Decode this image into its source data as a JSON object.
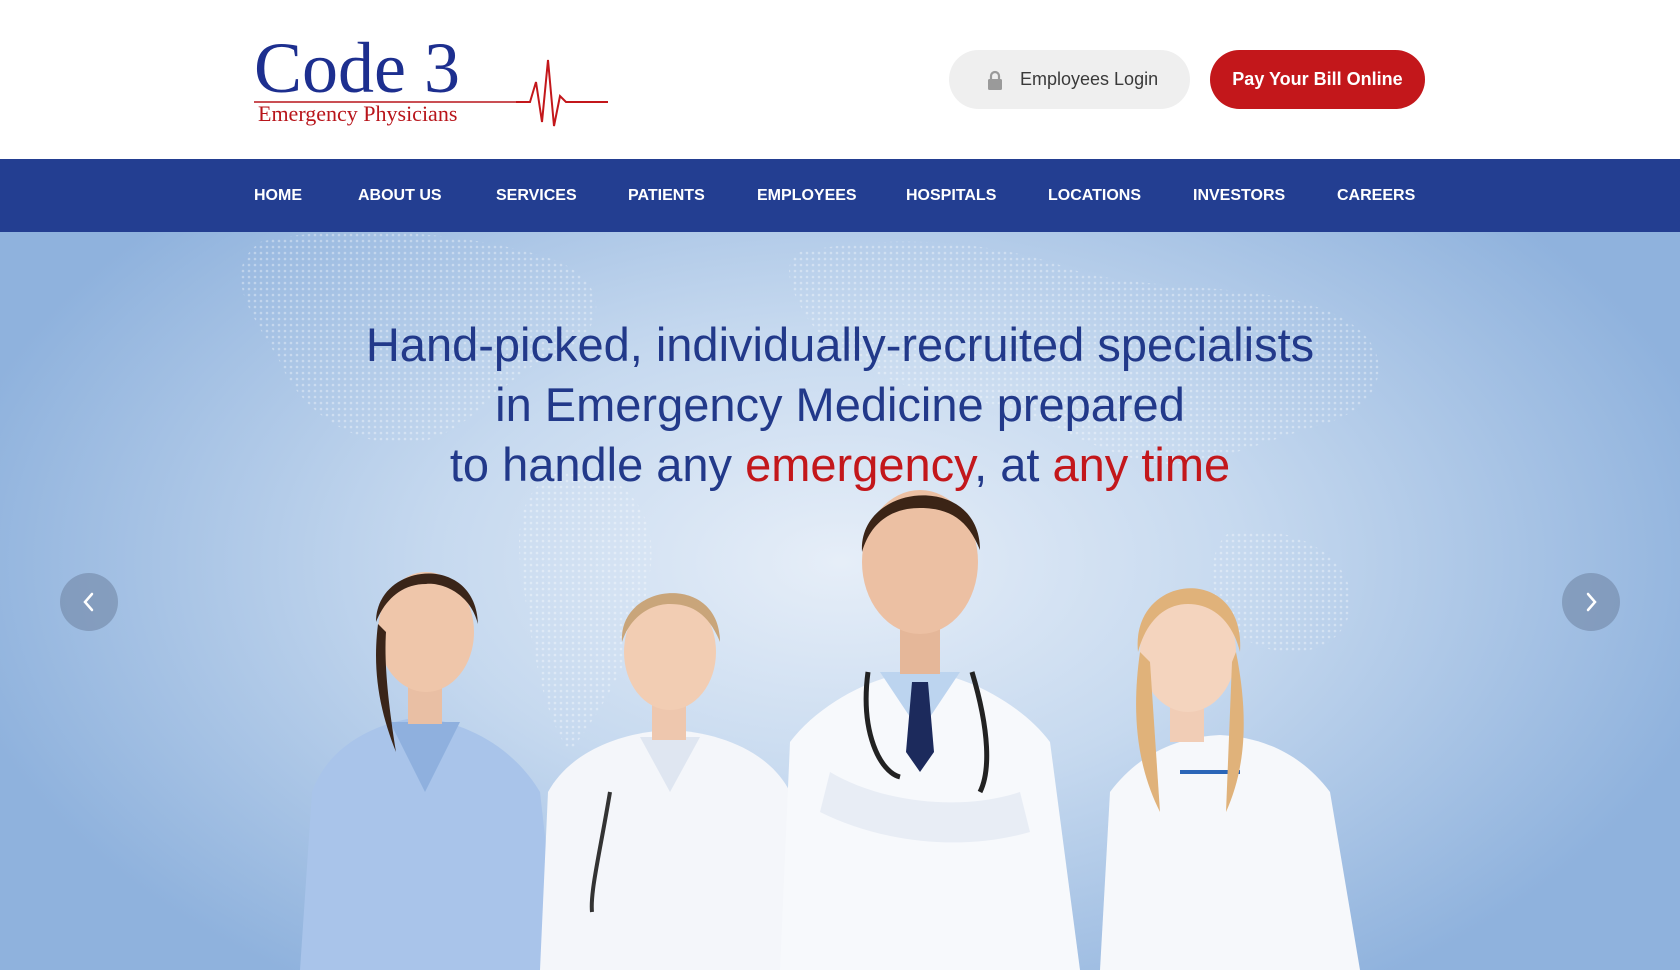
{
  "logo": {
    "line1": "Code 3",
    "line2": "Emergency Physicians",
    "heartbeat_icon": "heartbeat-line-icon",
    "accent_color": "#b8151b",
    "primary_color": "#1d2f8f"
  },
  "header": {
    "login_label": "Employees Login",
    "login_icon": "lock-icon",
    "pay_label": "Pay Your Bill Online",
    "pay_color": "#c3171b"
  },
  "nav": {
    "background": "#233e91",
    "items": [
      {
        "label": "HOME"
      },
      {
        "label": "ABOUT US"
      },
      {
        "label": "SERVICES"
      },
      {
        "label": "PATIENTS"
      },
      {
        "label": "EMPLOYEES"
      },
      {
        "label": "HOSPITALS"
      },
      {
        "label": "LOCATIONS"
      },
      {
        "label": "INVESTORS"
      },
      {
        "label": "CAREERS"
      }
    ]
  },
  "hero": {
    "line1": "Hand-picked, individually-recruited specialists",
    "line2": "in Emergency Medicine prepared",
    "line3_a": "to handle any ",
    "line3_b": "emergency",
    "line3_c": ", at ",
    "line3_d": "any time",
    "prev_icon": "chevron-left-icon",
    "next_icon": "chevron-right-icon",
    "image_subject": "four-doctors-photo"
  }
}
